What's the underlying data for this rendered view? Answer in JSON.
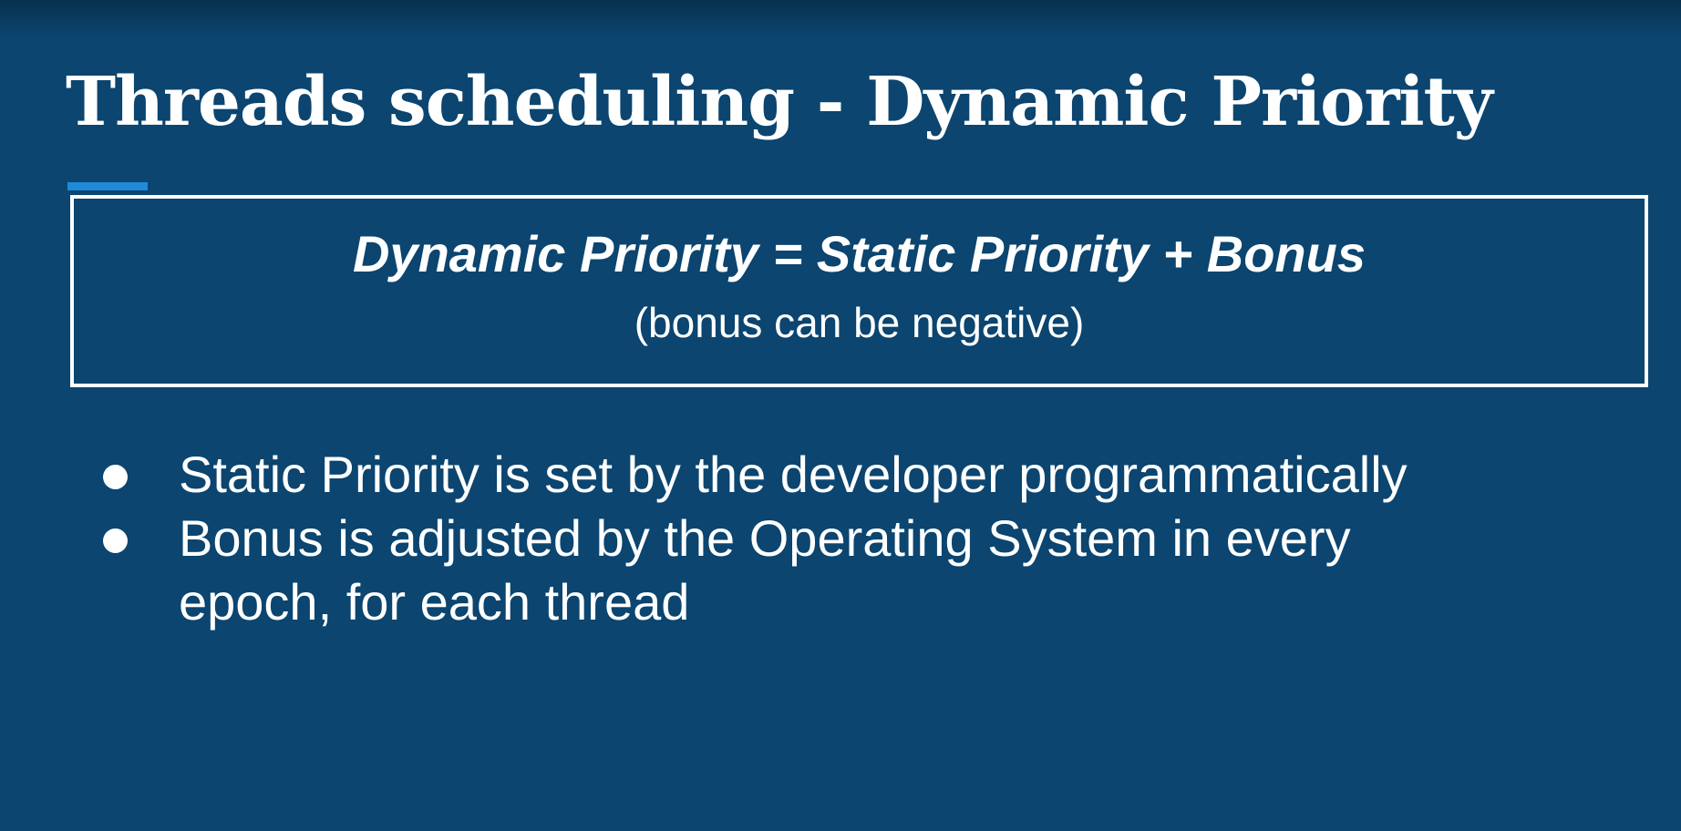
{
  "slide": {
    "title": "Threads scheduling - Dynamic Priority",
    "formula": "Dynamic Priority = Static Priority + Bonus",
    "formula_note": "(bonus can be negative)",
    "bullets": [
      "Static Priority is set by the developer programmatically",
      "Bonus is adjusted by the Operating System in every epoch, for each thread"
    ]
  },
  "colors": {
    "background": "#0b4570",
    "accent": "#1f8ad8",
    "text": "#ffffff"
  }
}
